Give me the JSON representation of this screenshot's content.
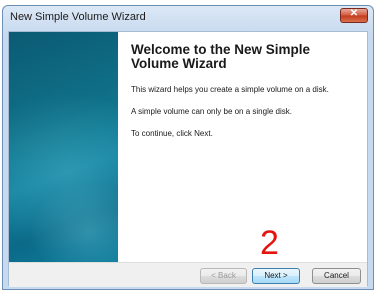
{
  "window": {
    "title": "New Simple Volume Wizard",
    "close_glyph": "✕"
  },
  "content": {
    "heading_line1": "Welcome to the New Simple",
    "heading_line2": "Volume Wizard",
    "paragraph1": "This wizard helps you create a simple volume on a disk.",
    "paragraph2": "A simple volume can only be on a single disk.",
    "paragraph3": "To continue, click Next."
  },
  "buttons": {
    "back": "< Back",
    "next": "Next >",
    "cancel": "Cancel"
  },
  "annotation": {
    "step": "2"
  }
}
